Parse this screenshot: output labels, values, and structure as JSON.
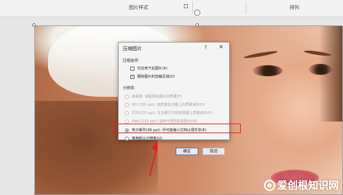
{
  "ribbon": {
    "group_picture_styles": "图片样式",
    "group_arrange": "排列"
  },
  "dialog": {
    "title": "压缩图片",
    "help": "?",
    "close": "✕",
    "compress_options_label": "压缩选项:",
    "apply_only_this": {
      "label": "仅应用于此图片(A)",
      "checked": false
    },
    "delete_cropped": {
      "label": "删除图片的剪裁区域(D)",
      "checked": true
    },
    "resolution_label": "分辨率:",
    "resolutions": [
      {
        "label": "高保真: 保留原始图片的质量(F)",
        "enabled": false,
        "selected": false
      },
      {
        "label": "HD (330 ppi): 高质量显示器上的质量良好(H)",
        "enabled": false,
        "selected": false
      },
      {
        "label": "打印(220 ppi): 在多数打印机和屏幕上质量良好(P)",
        "enabled": false,
        "selected": false
      },
      {
        "label": "Web (150 ppi): 适用于网页和投影仪(W)",
        "enabled": false,
        "selected": false
      },
      {
        "label": "电子邮件(96 ppi): 尽可能缩小文档以便共享(E)",
        "enabled": true,
        "selected": true
      },
      {
        "label": "使用默认分辨率(U)",
        "enabled": true,
        "selected": false
      }
    ],
    "ok_label": "确定",
    "cancel_label": "取消"
  },
  "watermark": {
    "text": "爱创根知识网"
  },
  "colors": {
    "highlight": "#e5201f",
    "default_button_border": "#3a7bd5"
  }
}
